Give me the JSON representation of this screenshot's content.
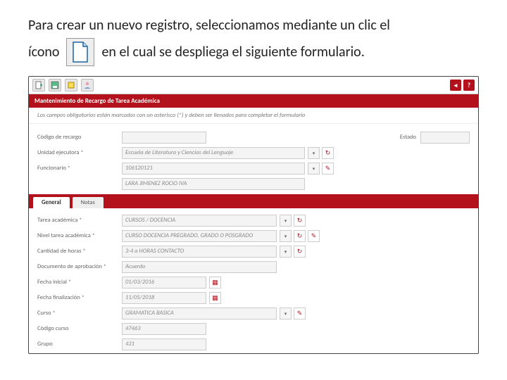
{
  "instruction": {
    "line1": "Para crear un nuevo registro, seleccionamos mediante un clic el",
    "iconWord": "ícono",
    "line2": "en el cual se despliega el siguiente formulario."
  },
  "app": {
    "title": "Mantenimiento de Recargo de Tarea Académica",
    "requiredNote": "Los campos obligatorios están marcados con un asterisco (*) y deben ser llenados para completar el formulario",
    "estadoLabel": "Estado",
    "fields": {
      "codigoRecargoLabel": "Código de recargo",
      "codigoRecargo": "",
      "unidadLabel": "Unidad ejecutora *",
      "unidad": "Escuela de Literatura y Ciencias del Lenguaje",
      "funcionarioLabel": "Funcionario *",
      "funcionarioId": "106120121",
      "funcionarioNombre": "LARA JIMENEZ ROCIO IVA",
      "tareaLabel": "Tarea académica *",
      "tarea": "CURSOS / DOCENCIA",
      "nivelLabel": "Nivel tarea académica *",
      "nivel": "CURSO DOCENCIA PREGRADO, GRADO O POSGRADO",
      "horasLabel": "Cantidad de horas *",
      "horas": "3-4 a HORAS CONTACTO",
      "docLabel": "Documento de aprobación *",
      "doc": "Acuerdo",
      "fechaIniLabel": "Fecha inicial *",
      "fechaIni": "01/03/2016",
      "fechaFinLabel": "Fecha finalización *",
      "fechaFin": "11/05/2018",
      "cursoLabel": "Curso *",
      "curso": "GRAMATICA BASICA",
      "codCursoLabel": "Código curso",
      "codCurso": "47463",
      "grupoLabel": "Grupo",
      "grupo": "431"
    },
    "tabs": {
      "general": "General",
      "notas": "Notas"
    }
  }
}
